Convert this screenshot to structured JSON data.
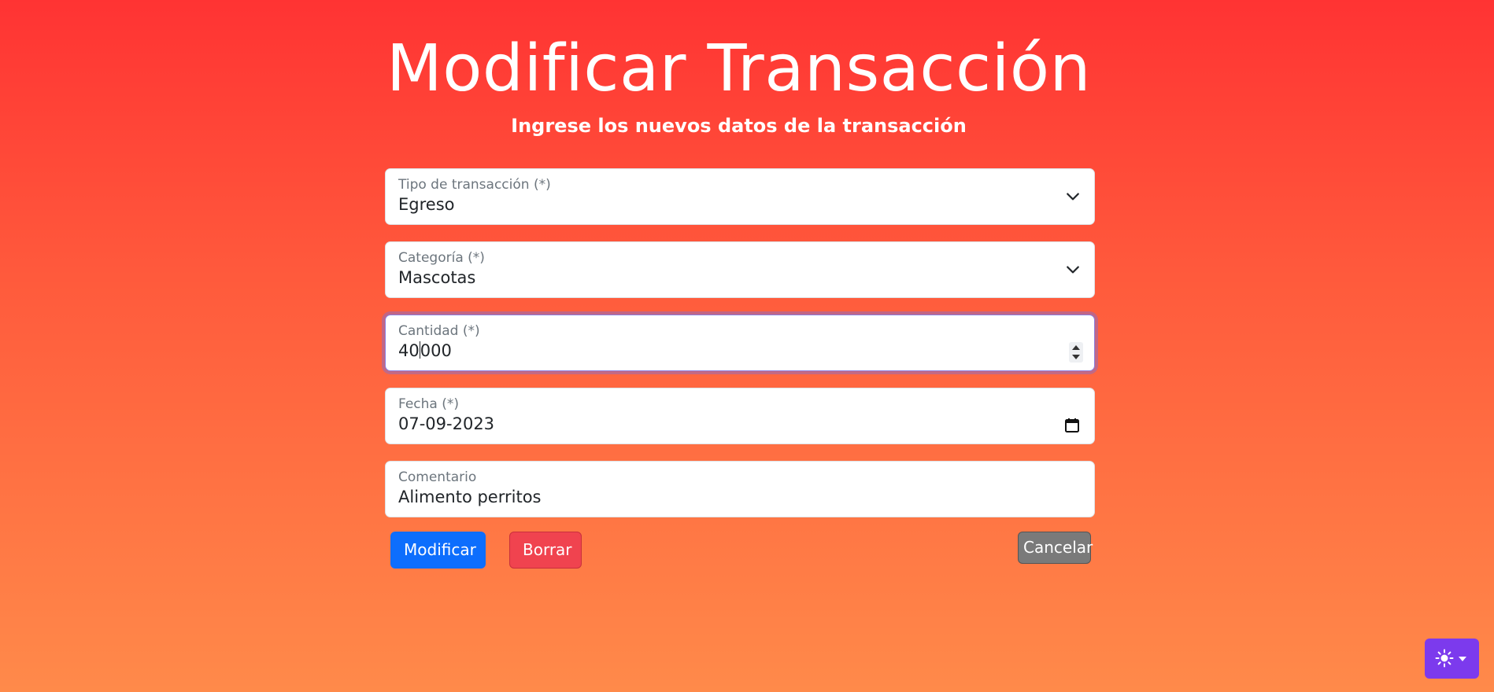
{
  "header": {
    "title": "Modificar Transacción",
    "subtitle": "Ingrese los nuevos datos de la transacción"
  },
  "form": {
    "tipo": {
      "label": "Tipo de transacción (*)",
      "value": "Egreso"
    },
    "categoria": {
      "label": "Categoría (*)",
      "value": "Mascotas"
    },
    "cantidad": {
      "label": "Cantidad (*)",
      "value_before_caret": "40",
      "value_after_caret": "000"
    },
    "fecha": {
      "label": "Fecha (*)",
      "value": "07-09-2023"
    },
    "comentario": {
      "label": "Comentario",
      "value": "Alimento perritos"
    }
  },
  "buttons": {
    "modify": "Modificar",
    "delete": "Borrar",
    "cancel": "Cancelar"
  },
  "theme_toggle": {
    "icon": "sun-icon"
  },
  "colors": {
    "primary": "#0d6efd",
    "danger": "#f0434f",
    "secondary": "#7a7a7a",
    "theme_toggle": "#7c3aed",
    "focus_ring": "#8a7fe0"
  }
}
